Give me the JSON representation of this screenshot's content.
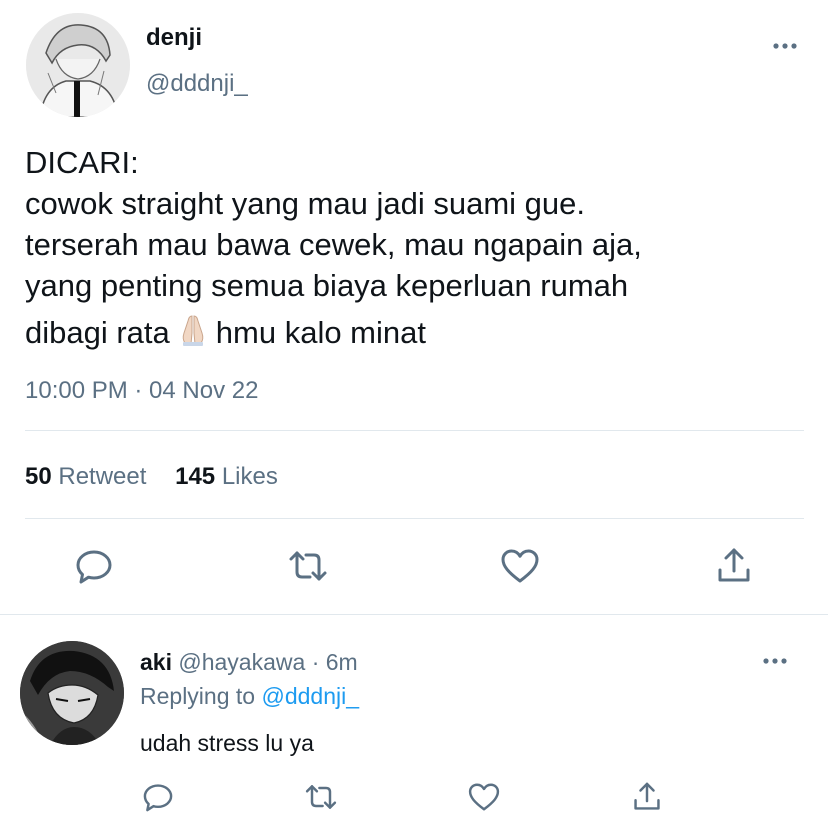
{
  "tweet": {
    "name": "denji",
    "handle": "@dddnji_",
    "text_lines": [
      "DICARI:",
      "cowok straight yang mau jadi suami gue.",
      "terserah mau bawa cewek, mau ngapain aja,",
      "yang penting semua biaya keperluan rumah",
      "dibagi rata",
      "hmu kalo minat"
    ],
    "emoji": "folded-hands",
    "timestamp": "10:00 PM · 04 Nov 22",
    "retweet_count": "50",
    "retweet_label": "Retweet",
    "likes_count": "145",
    "likes_label": "Likes"
  },
  "reply": {
    "name": "aki",
    "handle": "@hayakawa",
    "time": "· 6m",
    "replying_prefix": "Replying to",
    "replying_to": "@dddnji_",
    "text": "udah stress lu ya"
  },
  "icons": {
    "reply": "reply-icon",
    "retweet": "retweet-icon",
    "like": "heart-icon",
    "share": "share-icon",
    "more": "more-icon"
  },
  "colors": {
    "icon": "#5b7083",
    "link": "#1d9bf0",
    "text": "#0f1419",
    "secondary": "#5b7083"
  }
}
